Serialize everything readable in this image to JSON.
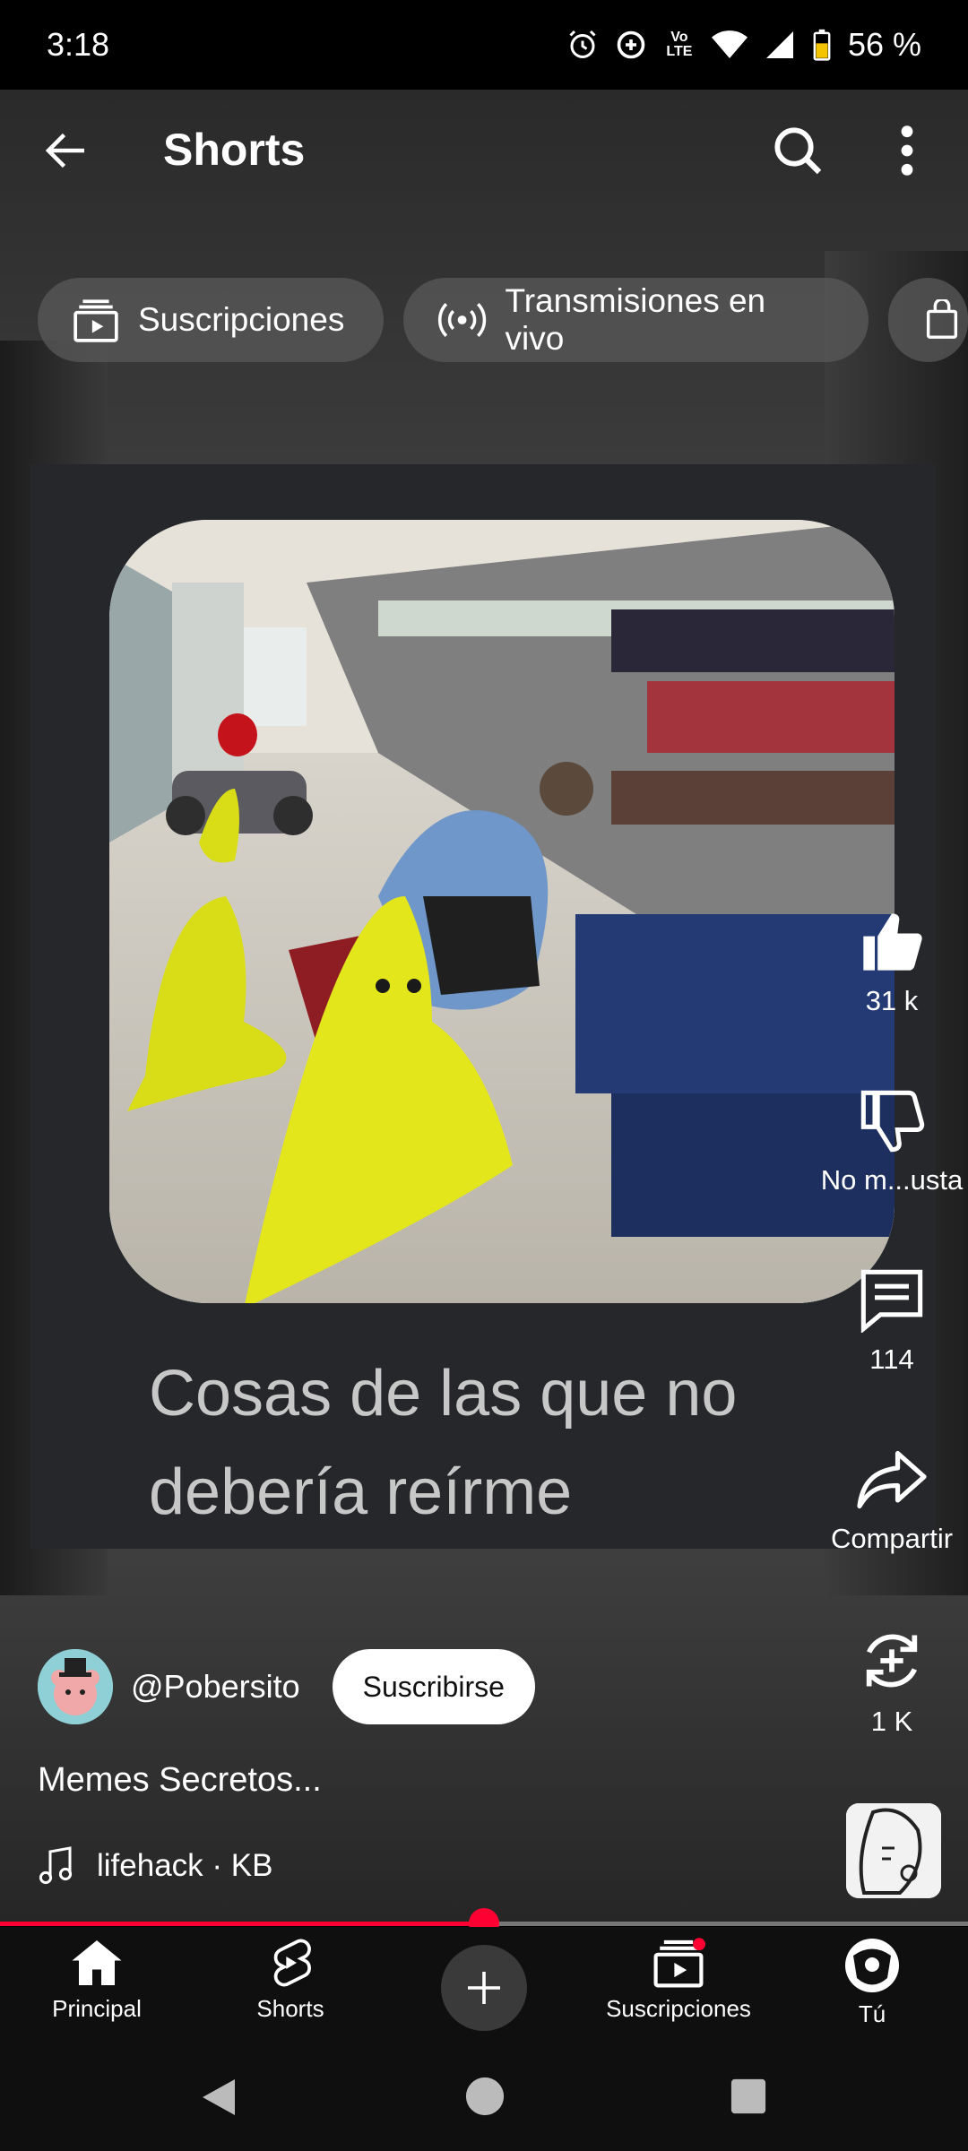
{
  "status_bar": {
    "time": "3:18",
    "battery": "56 %",
    "network": "Vo LTE"
  },
  "header": {
    "title": "Shorts"
  },
  "chips": [
    {
      "label": "Suscripciones",
      "icon": "subscriptions-icon"
    },
    {
      "label": "Transmisiones en vivo",
      "icon": "live-icon"
    },
    {
      "label": "",
      "icon": "shopping-bag-icon"
    }
  ],
  "video": {
    "caption": "Cosas de las que no debería reírme"
  },
  "actions": {
    "like": "31 k",
    "dislike": "No m...usta",
    "comments": "114",
    "share": "Compartir",
    "remix": "1 K"
  },
  "channel": {
    "handle": "@Pobersito",
    "subscribe": "Suscribirse"
  },
  "description": "Memes Secretos...",
  "music": "lifehack · KB",
  "progress": 0.5,
  "nav": [
    {
      "label": "Principal",
      "icon": "home-icon"
    },
    {
      "label": "Shorts",
      "icon": "shorts-icon"
    },
    {
      "label": "",
      "icon": "create-icon"
    },
    {
      "label": "Suscripciones",
      "icon": "subscriptions-icon"
    },
    {
      "label": "Tú",
      "icon": "profile-avatar"
    }
  ],
  "colors": {
    "accent": "#ff0033",
    "background": "#0f0f0f"
  }
}
